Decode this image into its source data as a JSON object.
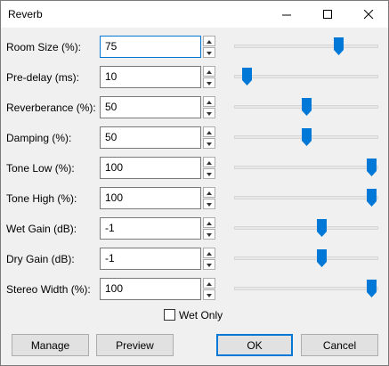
{
  "window": {
    "title": "Reverb",
    "minimize_icon": "minimize-icon",
    "maximize_icon": "maximize-icon",
    "close_icon": "close-icon"
  },
  "params": [
    {
      "label": "Room Size (%):",
      "value": "75",
      "slider": 0.75,
      "focused": true
    },
    {
      "label": "Pre-delay (ms):",
      "value": "10",
      "slider": 0.05
    },
    {
      "label": "Reverberance (%):",
      "value": "50",
      "slider": 0.5
    },
    {
      "label": "Damping (%):",
      "value": "50",
      "slider": 0.5
    },
    {
      "label": "Tone Low (%):",
      "value": "100",
      "slider": 1.0
    },
    {
      "label": "Tone High (%):",
      "value": "100",
      "slider": 1.0
    },
    {
      "label": "Wet Gain (dB):",
      "value": "-1",
      "slider": 0.62
    },
    {
      "label": "Dry Gain (dB):",
      "value": "-1",
      "slider": 0.62
    },
    {
      "label": "Stereo Width (%):",
      "value": "100",
      "slider": 1.0
    }
  ],
  "wet_only": {
    "label": "Wet Only",
    "checked": false
  },
  "buttons": {
    "manage": "Manage",
    "preview": "Preview",
    "ok": "OK",
    "cancel": "Cancel"
  },
  "colors": {
    "accent": "#0078d7",
    "thumb": "#0078d7"
  }
}
